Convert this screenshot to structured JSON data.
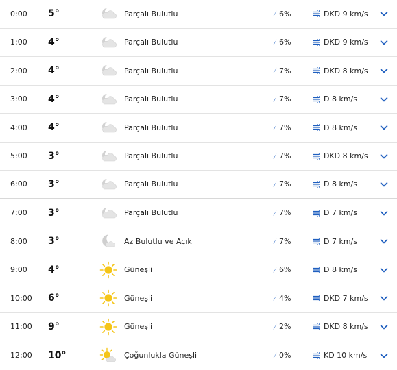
{
  "forecast": {
    "rows": [
      {
        "time": "0:00",
        "temp": "5°",
        "icon": "partly-cloudy-night-icon",
        "condition": "Parçalı Bulutlu",
        "rain": "6%",
        "wind": "DKD 9 km/s"
      },
      {
        "time": "1:00",
        "temp": "4°",
        "icon": "partly-cloudy-night-icon",
        "condition": "Parçalı Bulutlu",
        "rain": "6%",
        "wind": "DKD 9 km/s"
      },
      {
        "time": "2:00",
        "temp": "4°",
        "icon": "partly-cloudy-night-icon",
        "condition": "Parçalı Bulutlu",
        "rain": "7%",
        "wind": "DKD 8 km/s"
      },
      {
        "time": "3:00",
        "temp": "4°",
        "icon": "partly-cloudy-night-icon",
        "condition": "Parçalı Bulutlu",
        "rain": "7%",
        "wind": "D 8 km/s"
      },
      {
        "time": "4:00",
        "temp": "4°",
        "icon": "partly-cloudy-night-icon",
        "condition": "Parçalı Bulutlu",
        "rain": "7%",
        "wind": "D 8 km/s"
      },
      {
        "time": "5:00",
        "temp": "3°",
        "icon": "partly-cloudy-night-icon",
        "condition": "Parçalı Bulutlu",
        "rain": "7%",
        "wind": "DKD 8 km/s"
      },
      {
        "time": "6:00",
        "temp": "3°",
        "icon": "partly-cloudy-night-icon",
        "condition": "Parçalı Bulutlu",
        "rain": "7%",
        "wind": "D 8 km/s"
      },
      {
        "time": "7:00",
        "temp": "3°",
        "icon": "partly-cloudy-night-icon",
        "condition": "Parçalı Bulutlu",
        "rain": "7%",
        "wind": "D 7 km/s"
      },
      {
        "time": "8:00",
        "temp": "3°",
        "icon": "mostly-clear-night-icon",
        "condition": "Az Bulutlu ve Açık",
        "rain": "7%",
        "wind": "D 7 km/s"
      },
      {
        "time": "9:00",
        "temp": "4°",
        "icon": "sunny-icon",
        "condition": "Güneşli",
        "rain": "6%",
        "wind": "D 8 km/s"
      },
      {
        "time": "10:00",
        "temp": "6°",
        "icon": "sunny-icon",
        "condition": "Güneşli",
        "rain": "4%",
        "wind": "DKD 7 km/s"
      },
      {
        "time": "11:00",
        "temp": "9°",
        "icon": "sunny-icon",
        "condition": "Güneşli",
        "rain": "2%",
        "wind": "DKD 8 km/s"
      },
      {
        "time": "12:00",
        "temp": "10°",
        "icon": "mostly-sunny-icon",
        "condition": "Çoğunlukla Güneşli",
        "rain": "0%",
        "wind": "KD 10 km/s"
      }
    ]
  },
  "colors": {
    "accent": "#1f5fbf",
    "sun": "#f5c518",
    "cloud": "#c9c9c9",
    "divider": "#e3e3e3"
  }
}
